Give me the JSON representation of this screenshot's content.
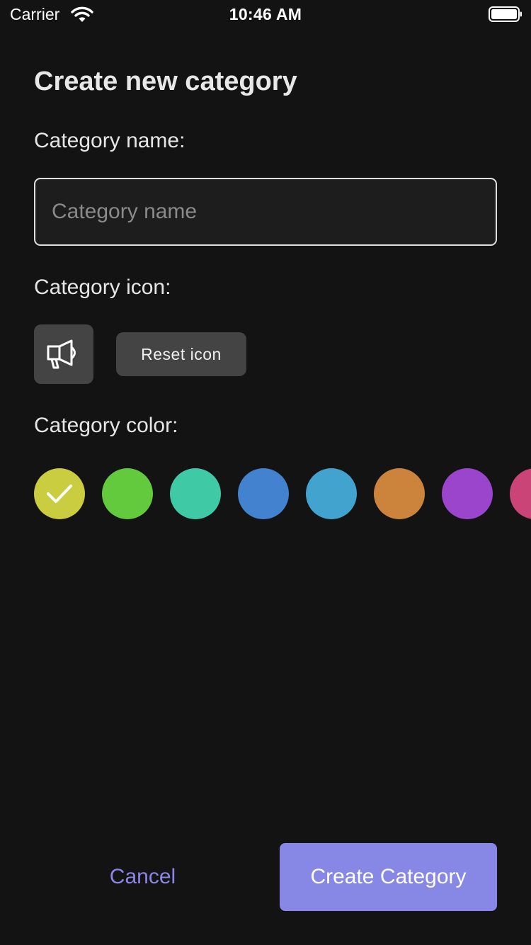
{
  "status_bar": {
    "carrier": "Carrier",
    "time": "10:46 AM",
    "icons": [
      "wifi-icon",
      "battery-icon"
    ]
  },
  "title": "Create new category",
  "name_section": {
    "label": "Category name:",
    "input_value": "",
    "placeholder": "Category name"
  },
  "icon_section": {
    "label": "Category icon:",
    "selected_icon": "megaphone-icon",
    "reset_label": "Reset icon"
  },
  "color_section": {
    "label": "Category color:",
    "selected_index": 0,
    "colors": [
      "#cbcd40",
      "#62ca3c",
      "#40c9a5",
      "#4282ce",
      "#42a4ce",
      "#cc843c",
      "#9b44cc",
      "#ca4478"
    ]
  },
  "actions": {
    "cancel_label": "Cancel",
    "create_label": "Create Category"
  },
  "theme": {
    "background": "#131313",
    "accent": "#8787e6",
    "accent_text": "#8b85e6"
  }
}
